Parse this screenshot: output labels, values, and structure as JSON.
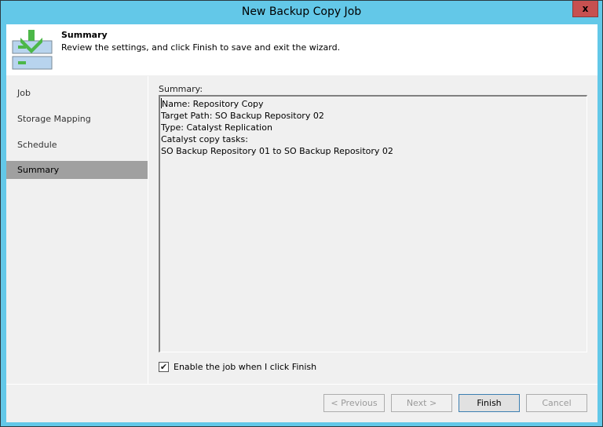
{
  "window": {
    "title": "New Backup Copy Job",
    "close_label": "x"
  },
  "header": {
    "title": "Summary",
    "description": "Review the settings, and click Finish to save and exit the wizard.",
    "icon": "backup-copy-download-icon"
  },
  "sidebar": {
    "items": [
      {
        "label": "Job",
        "active": false
      },
      {
        "label": "Storage Mapping",
        "active": false
      },
      {
        "label": "Schedule",
        "active": false
      },
      {
        "label": "Summary",
        "active": true
      }
    ]
  },
  "content": {
    "summary_label": "Summary:",
    "summary_lines": [
      "Name: Repository Copy",
      "Target Path: SO Backup Repository 02",
      "Type: Catalyst Replication",
      "Catalyst copy tasks:",
      "SO Backup Repository 01 to SO Backup Repository 02"
    ],
    "enable_checkbox": {
      "label": "Enable the job when I click Finish",
      "checked": true
    }
  },
  "buttons": {
    "previous": {
      "label": "< Previous",
      "enabled": false
    },
    "next": {
      "label": "Next >",
      "enabled": false
    },
    "finish": {
      "label": "Finish",
      "enabled": true
    },
    "cancel": {
      "label": "Cancel",
      "enabled": false
    }
  },
  "colors": {
    "title_bar": "#63c8e8",
    "close_button": "#c75050",
    "active_nav": "#a0a0a0",
    "icon_green": "#4cb748",
    "icon_blue": "#b8d4ee"
  }
}
